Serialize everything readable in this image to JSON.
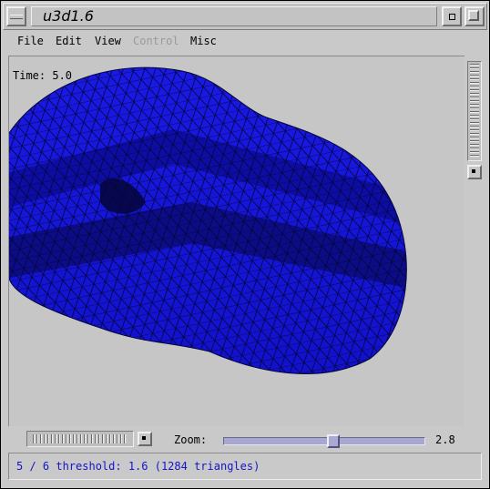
{
  "window": {
    "title": "u3d1.6",
    "menu_icon": "window-menu-icon",
    "minimize_icon": "minimize-icon",
    "maximize_icon": "maximize-icon"
  },
  "menubar": {
    "items": [
      {
        "label": "File",
        "enabled": true
      },
      {
        "label": "Edit",
        "enabled": true
      },
      {
        "label": "View",
        "enabled": true
      },
      {
        "label": "Control",
        "enabled": false
      },
      {
        "label": "Misc",
        "enabled": true
      }
    ]
  },
  "viewport": {
    "time_label": "Time: 5.0",
    "mesh_color": "#1414e0",
    "mesh_dark_color": "#08086a",
    "background_color": "#c6c6c6"
  },
  "controls": {
    "zoom_label": "Zoom:",
    "zoom_value": "2.8",
    "zoom_slider_fraction": 0.55
  },
  "status": {
    "text": "5 / 6 threshold: 1.6 (1284 triangles)",
    "color": "#1414c8"
  }
}
